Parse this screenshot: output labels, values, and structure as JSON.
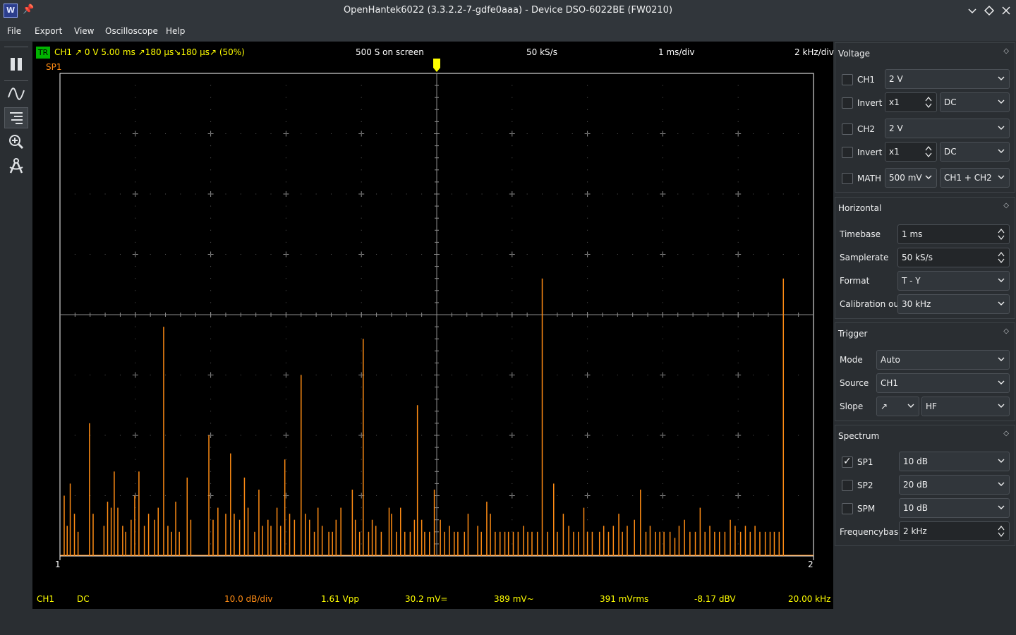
{
  "window": {
    "title": "OpenHantek6022 (3.3.2.2-7-gdfe0aaa) - Device DSO-6022BE (FW0210)"
  },
  "menu": [
    "File",
    "Export",
    "View",
    "Oscilloscope",
    "Help"
  ],
  "scope_header": {
    "trigger_badge": "TR",
    "channel": "CH1",
    "trigger_info": "↗  0 V  5.00 ms  ↗180 µs↘180 µs↗ (50%)",
    "samples_on_screen": "500 S on screen",
    "samplerate": "50 kS/s",
    "timebase": "1 ms/div",
    "freqbase": "2 kHz/div"
  },
  "spectrum_label": "SP1",
  "markers": {
    "left": "1",
    "right": "2"
  },
  "scope_footer": {
    "channel": "CH1",
    "coupling": "DC",
    "db_per_div": "10.0 dB/div",
    "vpp": "1.61 Vpp",
    "dc": "30.2 mV=",
    "ac": "389 mV~",
    "rms": "391 mVrms",
    "dbv": "-8.17 dBV",
    "freq": "20.00 kHz"
  },
  "spectrum_peaks": [
    [
      0.7,
      10
    ],
    [
      1.2,
      5
    ],
    [
      1.7,
      12
    ],
    [
      2.4,
      7
    ],
    [
      3.0,
      4
    ],
    [
      4.9,
      22
    ],
    [
      5.5,
      7
    ],
    [
      7.3,
      5
    ],
    [
      7.9,
      9
    ],
    [
      8.5,
      8
    ],
    [
      9.0,
      14
    ],
    [
      9.6,
      8
    ],
    [
      10.4,
      5
    ],
    [
      10.9,
      4
    ],
    [
      11.8,
      6
    ],
    [
      12.4,
      10
    ],
    [
      13.1,
      14
    ],
    [
      14.0,
      5
    ],
    [
      14.7,
      7
    ],
    [
      15.7,
      6
    ],
    [
      16.3,
      8
    ],
    [
      17.2,
      38
    ],
    [
      17.9,
      5
    ],
    [
      18.5,
      4
    ],
    [
      19.2,
      9
    ],
    [
      19.8,
      4
    ],
    [
      21.1,
      13
    ],
    [
      21.7,
      6
    ],
    [
      24.7,
      20
    ],
    [
      25.4,
      6
    ],
    [
      26.2,
      8
    ],
    [
      27.5,
      7
    ],
    [
      28.3,
      17
    ],
    [
      28.9,
      7
    ],
    [
      29.8,
      6
    ],
    [
      30.6,
      13
    ],
    [
      31.2,
      8
    ],
    [
      32.3,
      4
    ],
    [
      33.0,
      11
    ],
    [
      33.6,
      5
    ],
    [
      34.5,
      6
    ],
    [
      35.0,
      5
    ],
    [
      36.0,
      8
    ],
    [
      36.6,
      5
    ],
    [
      37.3,
      16
    ],
    [
      38.1,
      7
    ],
    [
      38.9,
      6
    ],
    [
      40.0,
      30
    ],
    [
      40.7,
      7
    ],
    [
      41.4,
      6
    ],
    [
      42.2,
      4
    ],
    [
      42.8,
      8
    ],
    [
      43.5,
      5
    ],
    [
      44.6,
      4
    ],
    [
      45.2,
      4
    ],
    [
      45.8,
      6
    ],
    [
      46.6,
      8
    ],
    [
      48.5,
      11
    ],
    [
      49.0,
      6
    ],
    [
      49.7,
      4
    ],
    [
      50.3,
      36
    ],
    [
      51.2,
      4
    ],
    [
      51.8,
      6
    ],
    [
      52.4,
      5
    ],
    [
      53.3,
      4
    ],
    [
      54.6,
      8
    ],
    [
      55.0,
      7
    ],
    [
      55.8,
      4
    ],
    [
      56.5,
      8
    ],
    [
      57.2,
      4
    ],
    [
      58.1,
      4
    ],
    [
      58.8,
      6
    ],
    [
      59.3,
      25
    ],
    [
      60.0,
      6
    ],
    [
      60.5,
      4
    ],
    [
      61.3,
      4
    ],
    [
      62.1,
      11
    ],
    [
      63.1,
      6
    ],
    [
      63.8,
      4
    ],
    [
      64.6,
      5
    ],
    [
      65.4,
      4
    ],
    [
      66.0,
      4
    ],
    [
      67.1,
      4
    ],
    [
      67.7,
      7
    ],
    [
      69.3,
      5
    ],
    [
      69.9,
      4
    ],
    [
      70.8,
      9
    ],
    [
      71.4,
      7
    ],
    [
      72.2,
      4
    ],
    [
      73.0,
      4
    ],
    [
      73.8,
      4
    ],
    [
      74.4,
      4
    ],
    [
      75.2,
      4
    ],
    [
      76.0,
      4
    ],
    [
      76.9,
      5
    ],
    [
      77.6,
      4
    ],
    [
      78.3,
      4
    ],
    [
      79.2,
      4
    ],
    [
      80.0,
      46
    ],
    [
      80.9,
      4
    ],
    [
      81.9,
      12
    ],
    [
      82.5,
      4
    ],
    [
      83.5,
      7
    ],
    [
      84.4,
      5
    ],
    [
      85.2,
      4
    ],
    [
      86.0,
      4
    ],
    [
      86.9,
      8
    ],
    [
      87.5,
      4
    ],
    [
      88.3,
      4
    ],
    [
      89.5,
      4
    ],
    [
      90.2,
      5
    ],
    [
      91.0,
      4
    ],
    [
      91.8,
      5
    ],
    [
      92.7,
      7
    ],
    [
      93.3,
      4
    ],
    [
      94.1,
      5
    ],
    [
      95.3,
      6
    ],
    [
      96.3,
      11
    ],
    [
      97.2,
      4
    ],
    [
      97.9,
      5
    ],
    [
      98.8,
      4
    ],
    [
      99.5,
      4
    ],
    [
      100.2,
      4
    ],
    [
      101.2,
      4
    ],
    [
      102.0,
      3
    ],
    [
      102.7,
      5
    ],
    [
      103.6,
      6
    ],
    [
      104.5,
      4
    ],
    [
      105.4,
      4
    ],
    [
      106.2,
      8
    ],
    [
      107.0,
      4
    ],
    [
      107.8,
      5
    ],
    [
      108.6,
      4
    ],
    [
      109.4,
      4
    ],
    [
      110.3,
      4
    ],
    [
      111.2,
      6
    ],
    [
      112.0,
      5
    ],
    [
      112.9,
      4
    ],
    [
      113.7,
      5
    ],
    [
      114.5,
      4
    ],
    [
      115.3,
      5
    ],
    [
      116.1,
      4
    ],
    [
      117.0,
      4
    ],
    [
      117.8,
      4
    ],
    [
      118.5,
      4
    ],
    [
      119.3,
      4
    ],
    [
      120.0,
      46
    ]
  ],
  "voltage_dock": {
    "title": "Voltage",
    "ch1": {
      "label": "CH1",
      "checked": false,
      "gain": "2 V"
    },
    "ch1_invert": {
      "label": "Invert",
      "checked": false,
      "probe": "x1",
      "coupling": "DC"
    },
    "ch2": {
      "label": "CH2",
      "checked": false,
      "gain": "2 V"
    },
    "ch2_invert": {
      "label": "Invert",
      "checked": false,
      "probe": "x1",
      "coupling": "DC"
    },
    "math": {
      "label": "MATH",
      "checked": false,
      "gain": "500 mV",
      "mode": "CH1 + CH2"
    }
  },
  "horizontal_dock": {
    "title": "Horizontal",
    "timebase_label": "Timebase",
    "timebase": "1 ms",
    "samplerate_label": "Samplerate",
    "samplerate": "50 kS/s",
    "format_label": "Format",
    "format": "T - Y",
    "calibration_label": "Calibration out",
    "calibration": "30 kHz"
  },
  "trigger_dock": {
    "title": "Trigger",
    "mode_label": "Mode",
    "mode": "Auto",
    "source_label": "Source",
    "source": "CH1",
    "slope_label": "Slope",
    "slope": "↗",
    "filter": "HF"
  },
  "spectrum_dock": {
    "title": "Spectrum",
    "sp1": {
      "label": "SP1",
      "checked": true,
      "value": "10 dB"
    },
    "sp2": {
      "label": "SP2",
      "checked": false,
      "value": "20 dB"
    },
    "spm": {
      "label": "SPM",
      "checked": false,
      "value": "10 dB"
    },
    "freqbase_label": "Frequencybase",
    "freqbase": "2 kHz"
  },
  "colors": {
    "scope_bg": "#000000",
    "grid": "#8c8c8c",
    "channel_text": "#ffff00",
    "spectrum": "#ff8c14",
    "trigger_badge": "#00b400"
  }
}
